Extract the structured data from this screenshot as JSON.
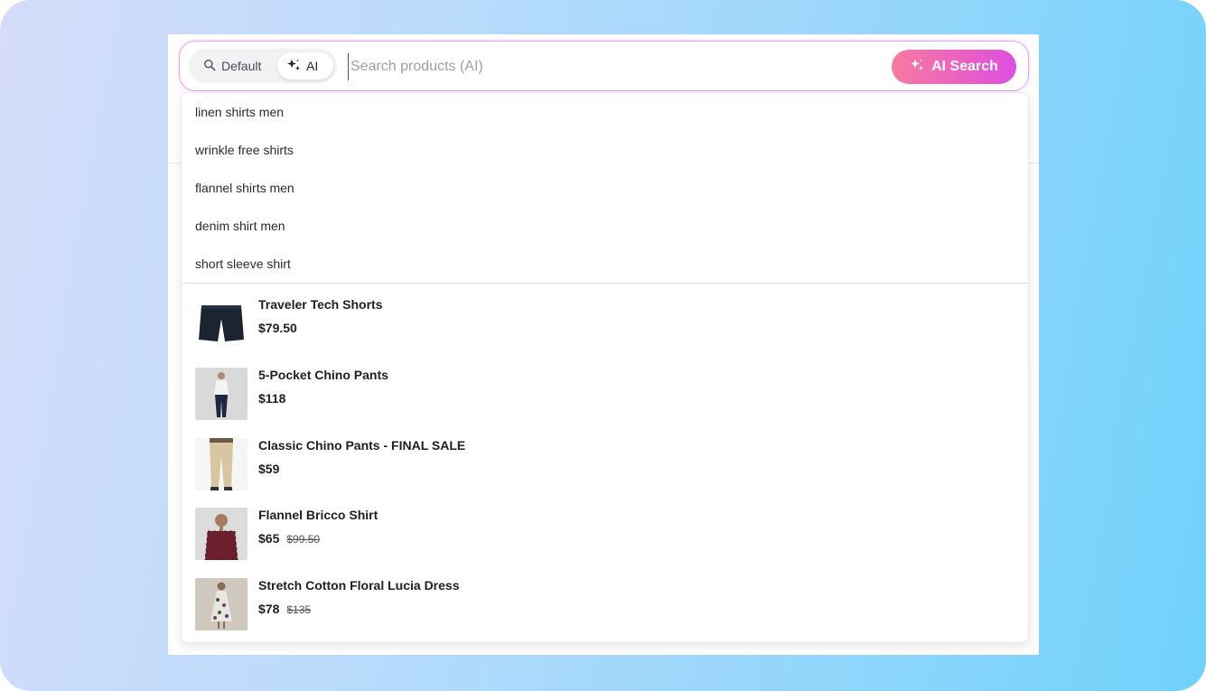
{
  "search": {
    "mode_default_label": "Default",
    "mode_ai_label": "AI",
    "active_mode": "AI",
    "placeholder": "Search products (AI)",
    "value": "",
    "button_label": "AI Search",
    "accent_gradient": [
      "#f77aa0",
      "#dc4fe0"
    ]
  },
  "suggestions": [
    "linen shirts men",
    "wrinkle free shirts",
    "flannel shirts men",
    "denim shirt men",
    "short sleeve shirt"
  ],
  "products": [
    {
      "name": "Traveler Tech Shorts",
      "price": "$79.50",
      "original_price": "",
      "thumbnail": "dark-shorts"
    },
    {
      "name": "5-Pocket Chino Pants",
      "price": "$118",
      "original_price": "",
      "thumbnail": "man-navy-pants"
    },
    {
      "name": "Classic Chino Pants - FINAL SALE",
      "price": "$59",
      "original_price": "",
      "thumbnail": "khaki-pants"
    },
    {
      "name": "Flannel Bricco Shirt",
      "price": "$65",
      "original_price": "$99.50",
      "thumbnail": "man-plaid-shirt"
    },
    {
      "name": "Stretch Cotton Floral Lucia Dress",
      "price": "$78",
      "original_price": "$135",
      "thumbnail": "woman-floral-dress"
    }
  ]
}
